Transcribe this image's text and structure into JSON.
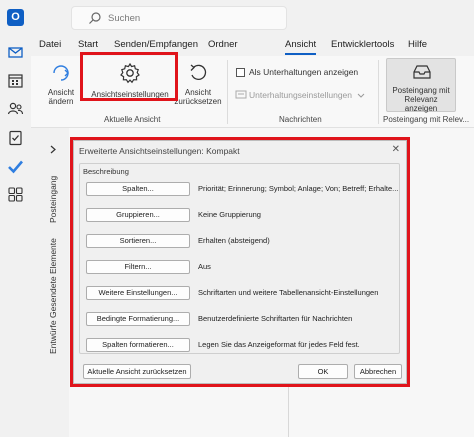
{
  "search": {
    "placeholder": "Suchen"
  },
  "app": {
    "logo_letter": "O"
  },
  "tabs": [
    "Datei",
    "Start",
    "Senden/Empfangen",
    "Ordner",
    "Ansicht",
    "Entwicklertools",
    "Hilfe"
  ],
  "ribbon": {
    "change_view": "Ansicht\nändern",
    "view_settings": "Ansichtseinstellungen",
    "reset_view": "Ansicht\nzurücksetzen",
    "group_current_view": "Aktuelle Ansicht",
    "show_as_conversations": "Als Unterhaltungen anzeigen",
    "conversation_settings": "Unterhaltungseinstellungen",
    "group_messages": "Nachrichten",
    "focused_inbox": "Posteingang mit\nRelevanz anzeigen",
    "group_focused": "Posteingang mit Relev..."
  },
  "sidebar": {
    "folders": [
      "Posteingang",
      "Gesendete Elemente",
      "Entwürfe"
    ]
  },
  "dialog": {
    "title": "Erweiterte Ansichtseinstellungen: Kompakt",
    "close": "✕",
    "legend": "Beschreibung",
    "rows": [
      {
        "button": "Spalten...",
        "desc": "Priorität; Erinnerung; Symbol; Anlage; Von; Betreff; Erhalte..."
      },
      {
        "button": "Gruppieren...",
        "desc": "Keine Gruppierung"
      },
      {
        "button": "Sortieren...",
        "desc": "Erhalten (absteigend)"
      },
      {
        "button": "Filtern...",
        "desc": "Aus"
      },
      {
        "button": "Weitere Einstellungen...",
        "desc": "Schriftarten und weitere Tabellenansicht-Einstellungen"
      },
      {
        "button": "Bedingte Formatierung...",
        "desc": "Benutzerdefinierte Schriftarten für Nachrichten"
      },
      {
        "button": "Spalten formatieren...",
        "desc": "Legen Sie das Anzeigeformat für jedes Feld fest."
      }
    ],
    "reset_button": "Aktuelle Ansicht zurücksetzen",
    "ok_button": "OK",
    "cancel_button": "Abbrechen"
  },
  "colors": {
    "accent": "#0f5fc4",
    "highlight": "#e0141b"
  }
}
